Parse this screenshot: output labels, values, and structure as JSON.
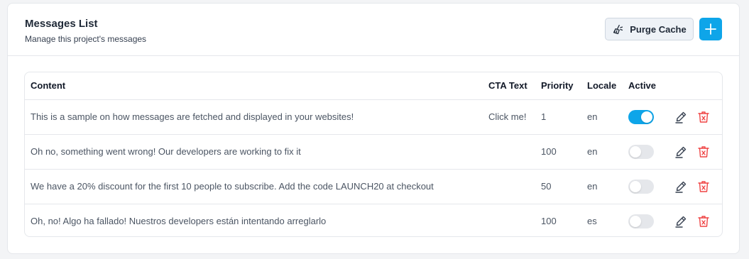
{
  "header": {
    "title": "Messages List",
    "subtitle": "Manage this project's messages",
    "purge_label": "Purge Cache",
    "purge_icon": "broom-icon",
    "add_icon": "plus-icon",
    "add_button_color": "#0ea5e9"
  },
  "table": {
    "columns": {
      "content": "Content",
      "cta": "CTA Text",
      "priority": "Priority",
      "locale": "Locale",
      "active": "Active"
    },
    "rows": [
      {
        "content": "This is a sample on how messages are fetched and displayed in your websites!",
        "cta": "Click me!",
        "priority": "1",
        "locale": "en",
        "active": true
      },
      {
        "content": "Oh no, something went wrong! Our developers are working to fix it",
        "cta": "",
        "priority": "100",
        "locale": "en",
        "active": false
      },
      {
        "content": "We have a 20% discount for the first 10 people to subscribe. Add the code LAUNCH20 at checkout",
        "cta": "",
        "priority": "50",
        "locale": "en",
        "active": false
      },
      {
        "content": "Oh, no! Algo ha fallado! Nuestros developers están intentando arreglarlo",
        "cta": "",
        "priority": "100",
        "locale": "es",
        "active": false
      }
    ],
    "row_icons": {
      "edit": "edit-icon",
      "delete": "trash-icon"
    },
    "colors": {
      "toggle_on": "#0ea5e9",
      "toggle_off": "#e5e7eb",
      "delete": "#ef4444"
    }
  }
}
